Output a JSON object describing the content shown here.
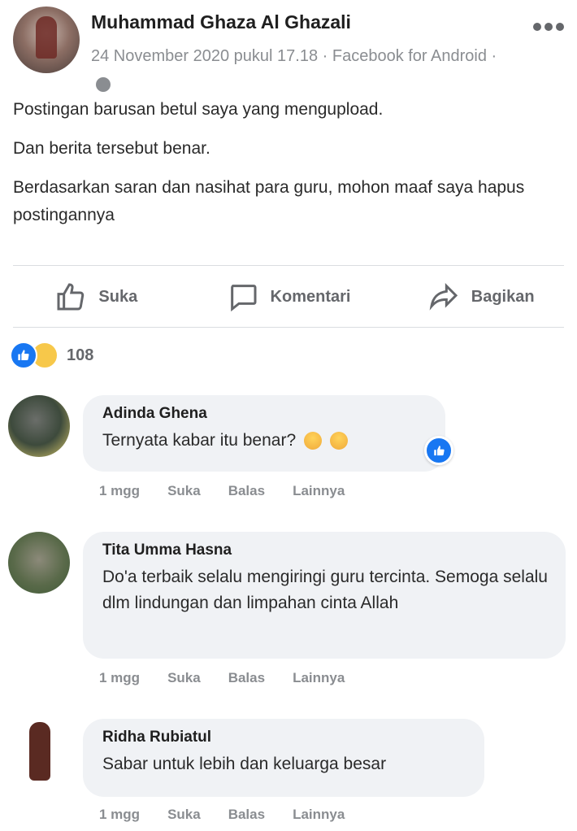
{
  "post": {
    "author": "Muhammad Ghaza Al Ghazali",
    "meta": "24 November 2020 pukul 17.18 · Facebook for Android ·",
    "paragraphs": [
      "Postingan barusan betul saya yang mengupload.",
      "Dan berita tersebut benar.",
      "Berdasarkan saran dan nasihat para guru, mohon maaf saya hapus postingannya"
    ]
  },
  "actions": {
    "like": "Suka",
    "comment": "Komentari",
    "share": "Bagikan"
  },
  "reactions": {
    "count": "108"
  },
  "comments": [
    {
      "name": "Adinda Ghena",
      "text": "Ternyata kabar itu benar?",
      "time": "1 mgg",
      "like": "Suka",
      "reply": "Balas",
      "more": "Lainnya"
    },
    {
      "name": "Tita Umma Hasna",
      "text": "Do'a terbaik selalu mengiringi guru tercinta. Semoga selalu dlm lindungan dan limpahan cinta Allah",
      "time": "1 mgg",
      "like": "Suka",
      "reply": "Balas",
      "more": "Lainnya"
    },
    {
      "name": "Ridha Rubiatul",
      "text": "Sabar untuk lebih dan keluarga besar",
      "time": "1 mgg",
      "like": "Suka",
      "reply": "Balas",
      "more": "Lainnya"
    }
  ],
  "colors": {
    "accent": "#1877f2",
    "bubble": "#f0f2f5",
    "muted": "#65676b"
  }
}
